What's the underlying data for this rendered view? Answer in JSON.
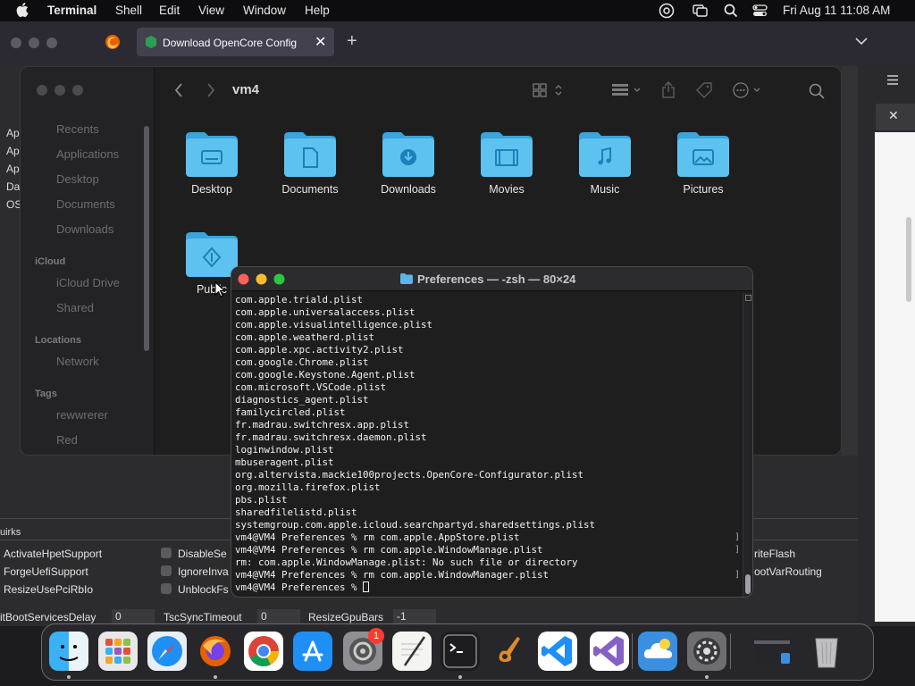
{
  "menubar": {
    "app_name": "Terminal",
    "items": [
      "Shell",
      "Edit",
      "View",
      "Window",
      "Help"
    ],
    "clock": "Fri Aug 11  11:08 AM"
  },
  "browser": {
    "tab_title": "Download OpenCore Configurat"
  },
  "background_app": {
    "left_list": [
      "Ap",
      "Ap",
      "Ap",
      "Da",
      "OS"
    ],
    "section_label": "uirks",
    "quirks_col1": [
      "ActivateHpetSupport",
      "ForgeUefiSupport",
      "ResizeUsePciRbIo"
    ],
    "quirks_col2": [
      "DisableSe",
      "IgnoreInva",
      "UnblockFs"
    ],
    "quirks_col3": [
      "riteFlash",
      "ootVarRouting"
    ],
    "bottom_fields": [
      {
        "label": "itBootServicesDelay",
        "value": "0"
      },
      {
        "label": "TscSyncTimeout",
        "value": "0"
      },
      {
        "label": "ResizeGpuBars",
        "value": "-1"
      }
    ]
  },
  "finder": {
    "path_title": "vm4",
    "sidebar": {
      "favorites": [
        "Recents",
        "Applications",
        "Desktop",
        "Documents",
        "Downloads"
      ],
      "icloud_header": "iCloud",
      "icloud": [
        "iCloud Drive",
        "Shared"
      ],
      "locations_header": "Locations",
      "locations": [
        "Network"
      ],
      "tags_header": "Tags",
      "tags": [
        "rewwrerer",
        "Red"
      ]
    },
    "folders": [
      "Desktop",
      "Documents",
      "Downloads",
      "Movies",
      "Music",
      "Pictures",
      "Public"
    ]
  },
  "terminal": {
    "title": "Preferences — -zsh — 80×24",
    "lines": [
      "com.apple.triald.plist",
      "com.apple.universalaccess.plist",
      "com.apple.visualintelligence.plist",
      "com.apple.weatherd.plist",
      "com.apple.xpc.activity2.plist",
      "com.google.Chrome.plist",
      "com.google.Keystone.Agent.plist",
      "com.microsoft.VSCode.plist",
      "diagnostics_agent.plist",
      "familycircled.plist",
      "fr.madrau.switchresx.app.plist",
      "fr.madrau.switchresx.daemon.plist",
      "loginwindow.plist",
      "mbuseragent.plist",
      "org.altervista.mackie100projects.OpenCore-Configurator.plist",
      "org.mozilla.firefox.plist",
      "pbs.plist",
      "sharedfilelistd.plist",
      "systemgroup.com.apple.icloud.searchpartyd.sharedsettings.plist",
      "vm4@VM4 Preferences % rm com.apple.AppStore.plist",
      "vm4@VM4 Preferences % rm com.apple.WindowManage.plist",
      "rm: com.apple.WindowManage.plist: No such file or directory",
      "vm4@VM4 Preferences % rm com.apple.WindowManager.plist",
      "vm4@VM4 Preferences % "
    ]
  },
  "dock": {
    "apps": [
      "finder-icon",
      "launchpad-icon",
      "safari-icon",
      "firefox-icon",
      "chrome-icon",
      "app-store-icon",
      "system-settings-icon",
      "textedit-icon",
      "terminal-icon",
      "garageband-icon",
      "vscode-icon",
      "visual-studio-icon",
      "cloud-app-icon",
      "utility-icon",
      "window-preview-icon",
      "trash-icon"
    ],
    "settings_badge": "1"
  }
}
